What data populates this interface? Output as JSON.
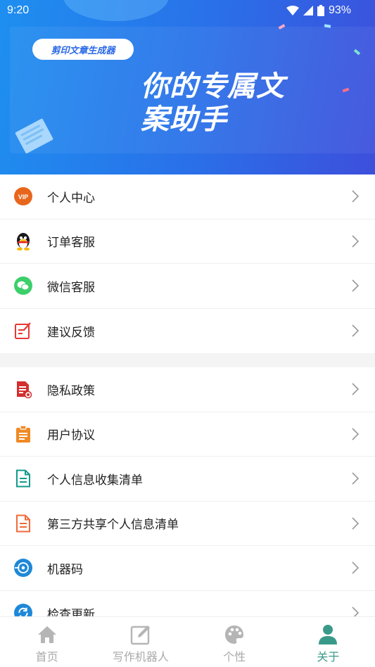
{
  "status_bar": {
    "time": "9:20",
    "battery": "93%"
  },
  "header": {
    "app_name": "剪印文章生成器",
    "slogan_line1": "你的专属文",
    "slogan_line2": "案助手"
  },
  "menu_group1": [
    {
      "label": "个人中心",
      "icon": "vip-icon"
    },
    {
      "label": "订单客服",
      "icon": "qq-penguin-icon"
    },
    {
      "label": "微信客服",
      "icon": "wechat-icon"
    },
    {
      "label": "建议反馈",
      "icon": "feedback-edit-icon"
    }
  ],
  "menu_group2": [
    {
      "label": "隐私政策",
      "icon": "privacy-document-icon"
    },
    {
      "label": "用户协议",
      "icon": "clipboard-icon"
    },
    {
      "label": "个人信息收集清单",
      "icon": "document-list-icon"
    },
    {
      "label": "第三方共享个人信息清单",
      "icon": "document-list-icon"
    },
    {
      "label": "机器码",
      "icon": "machine-code-icon"
    },
    {
      "label": "检查更新",
      "icon": "refresh-icon"
    }
  ],
  "vip_badge_text": "VIP",
  "bottom_nav": [
    {
      "label": "首页",
      "icon": "home-icon",
      "active": false
    },
    {
      "label": "写作机器人",
      "icon": "edit-icon",
      "active": false
    },
    {
      "label": "个性",
      "icon": "palette-icon",
      "active": false
    },
    {
      "label": "关于",
      "icon": "person-icon",
      "active": true
    }
  ],
  "colors": {
    "accent_active": "#3a9a8a",
    "header_start": "#1e8ff0",
    "header_end": "#3d4fdc"
  }
}
